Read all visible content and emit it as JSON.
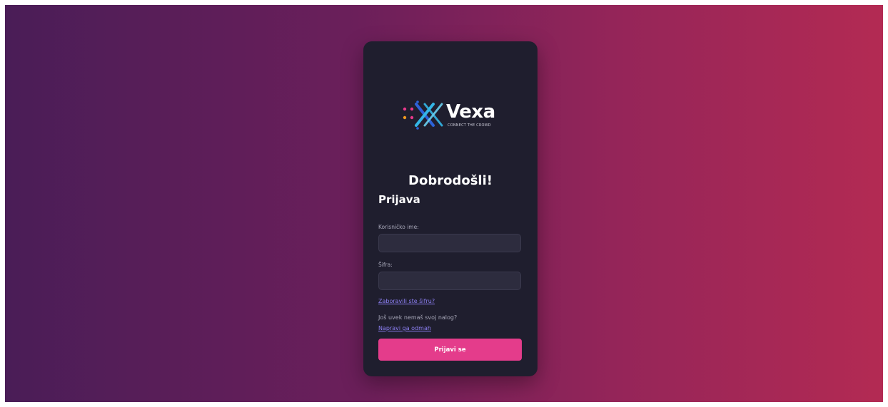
{
  "brand": {
    "name": "Vexa",
    "tagline": "CONNECT THE CROWD"
  },
  "auth": {
    "welcome": "Dobrodošli!",
    "title": "Prijava",
    "username_label": "Korisničko ime:",
    "username_value": "",
    "password_label": "Šifra:",
    "password_value": "",
    "forgot_link": "Zaboravili ste šifru?",
    "no_account_text": "Još uvek nemaš svoj nalog?",
    "create_link": "Napravi ga odmah",
    "submit_label": "Prijavi se"
  },
  "colors": {
    "background_start": "#4a1d57",
    "background_end": "#b32a53",
    "card": "#1f1e2e",
    "accent": "#e43c8b",
    "link": "#8c7ff2"
  }
}
